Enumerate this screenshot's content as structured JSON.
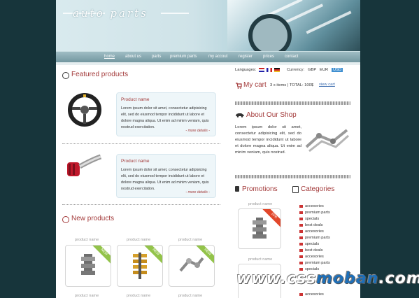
{
  "header": {
    "logo_text": "auto parts"
  },
  "nav": {
    "items": [
      {
        "label": "home",
        "active": true
      },
      {
        "label": "about us"
      },
      {
        "label": "parts"
      },
      {
        "label": "premium parts"
      },
      {
        "label": "my accout"
      },
      {
        "label": "register"
      },
      {
        "label": "prices"
      },
      {
        "label": "contact"
      }
    ]
  },
  "featured": {
    "title": "Featured products",
    "products": [
      {
        "name": "Product name",
        "text": "Lorem ipsum dolor sit amet, consectetur adipisicing elit, sed do eiusmod tempor incididunt ut labore et dolore magna aliqua. Ut enim ad minim veniam, quis nostrud exercitation.",
        "more": "- more details -",
        "image": "steering-wheel"
      },
      {
        "name": "Product name",
        "text": "Lorem ipsum dolor sit amet, consectetur adipisicing elit, sed do eiusmod tempor incididunt ut labore et dolore magna aliqua. Ut enim ad minim veniam, quis nostrud exercitation.",
        "more": "- more details -",
        "image": "air-filter"
      }
    ]
  },
  "new_products": {
    "title": "New products",
    "items": [
      {
        "name": "product name",
        "badge": "NEW",
        "image": "gearbox"
      },
      {
        "name": "product name",
        "badge": "NEW",
        "image": "spring"
      },
      {
        "name": "product name",
        "badge": "NEW",
        "image": "exhaust"
      }
    ],
    "row2_labels": [
      "product name",
      "product name",
      "product name"
    ]
  },
  "settings": {
    "languages_label": "Languages:",
    "currency_label": "Currency:",
    "currencies": [
      {
        "code": "GBP"
      },
      {
        "code": "EUR"
      },
      {
        "code": "USD",
        "active": true
      }
    ]
  },
  "cart": {
    "title": "My cart",
    "summary": "3 x items | TOTAL: 100$",
    "view_link": "view cart"
  },
  "about": {
    "title": "About Our Shop",
    "text": "Lorem ipsum dolor sit amet, consectetur adipisicing elit, sed do eiusmod tempor incididunt ut labore et dolore magna aliqua. Ut enim ad minim veniam, quis nostrud."
  },
  "promotions": {
    "title": "Promotions",
    "items": [
      {
        "name": "product name",
        "badge": "15%"
      },
      {
        "name": "product name"
      }
    ]
  },
  "categories": {
    "title": "Categories",
    "items": [
      "accesories",
      "premium parts",
      "specials",
      "best deals",
      "accesories",
      "premium parts",
      "specials",
      "best deals",
      "accesories",
      "premium parts",
      "specials",
      "accesories"
    ]
  },
  "watermark": {
    "part1": "www.css",
    "part2": "moban",
    "part3": ".com"
  },
  "colors": {
    "accent": "#a33a3a",
    "new_badge": "#93c34a",
    "promo_badge": "#e2472b",
    "usd_badge": "#3f8fd0"
  }
}
